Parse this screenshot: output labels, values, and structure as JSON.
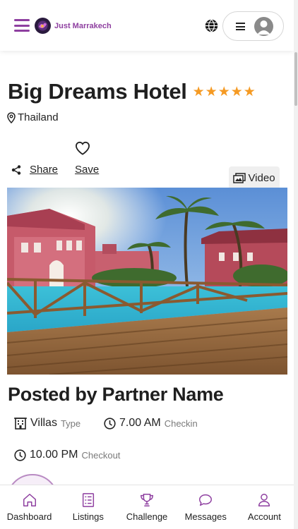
{
  "header": {
    "logo_text": "Just Marrakech",
    "menu_icon": "hamburger-icon",
    "language_icon": "globe-icon",
    "account_menu_icon": "menu-icon",
    "avatar_icon": "user-avatar-icon",
    "accent_color": "#8e3fa0"
  },
  "listing": {
    "title": "Big Dreams Hotel",
    "rating_stars": 5,
    "star_color": "#f59a23",
    "location": "Thailand",
    "share_label": "Share",
    "save_label": "Save",
    "video_label": "Video",
    "posted_by": "Posted by Partner Name",
    "type_value": "Villas",
    "type_label": "Type",
    "checkin_value": "7.00 AM",
    "checkin_label": "Checkin",
    "checkout_value": "10.00 PM",
    "checkout_label": "Checkout"
  },
  "bottom_nav": {
    "items": [
      {
        "label": "Dashboard",
        "icon": "home-icon"
      },
      {
        "label": "Listings",
        "icon": "list-icon"
      },
      {
        "label": "Challenge",
        "icon": "trophy-icon"
      },
      {
        "label": "Messages",
        "icon": "chat-icon"
      },
      {
        "label": "Account",
        "icon": "user-icon"
      }
    ]
  }
}
